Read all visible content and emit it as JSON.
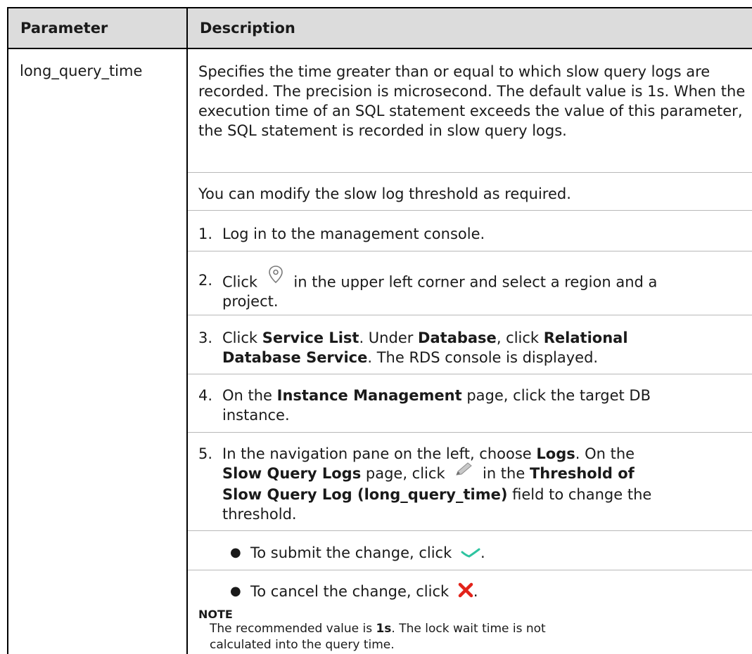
{
  "table": {
    "header": {
      "col1": "Parameter",
      "col2": "Description"
    },
    "row": {
      "parameter": "long_query_time",
      "intro": "Specifies the time greater than or equal to which slow query logs are recorded. The precision is microsecond. The default value is 1s. When the execution time of an SQL statement exceeds the value of this parameter, the SQL statement is recorded in slow query logs.",
      "modify_text": "You can modify the slow log threshold as required.",
      "steps": {
        "s1": {
          "num": "1.",
          "text": "Log in to the management console."
        },
        "s2": {
          "num": "2.",
          "a": "Click",
          "b": "in the upper left corner and select a region and a",
          "c": "project."
        },
        "s3": {
          "num": "3.",
          "a": "Click ",
          "b": "Service List",
          "c": ". Under ",
          "d": "Database",
          "e": ", click ",
          "f": "Relational",
          "g": "Database Service",
          "h": ". The RDS console is displayed."
        },
        "s4": {
          "num": "4.",
          "a": "On the ",
          "b": "Instance Management",
          "c": " page, click the target DB",
          "d": "instance."
        },
        "s5": {
          "num": "5.",
          "a": "In the navigation pane on the left, choose ",
          "b": "Logs",
          "c": ". On the",
          "d": "Slow Query Logs",
          "e": " page, click",
          "f": "in the ",
          "g": "Threshold of",
          "h": "Slow Query Log (long_query_time)",
          "i": " field to change the",
          "j": "threshold."
        }
      },
      "bullets": {
        "submit": "To submit the change, click",
        "cancel": "To cancel the change, click",
        "period": "."
      },
      "note": {
        "label": "NOTE",
        "a": "The recommended value is ",
        "b": "1s",
        "c": ". The lock wait time is not",
        "d": "calculated into the query time."
      }
    }
  },
  "icons": {
    "location": "location-pin-icon",
    "edit": "pencil-edit-icon",
    "confirm": "check-icon",
    "cancel": "close-x-icon"
  },
  "colors": {
    "header_bg": "#dcdcdc",
    "confirm": "#2ec4a0",
    "cancel": "#e2231a"
  }
}
